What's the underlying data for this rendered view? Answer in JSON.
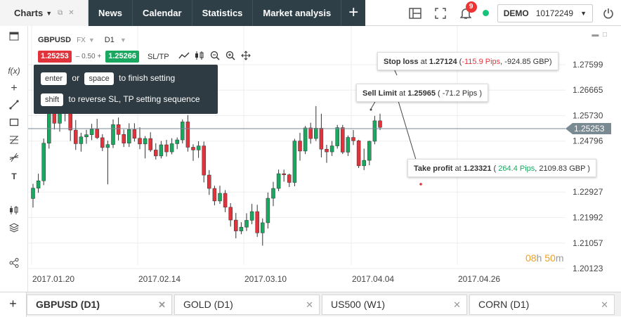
{
  "top_menu": {
    "label": "Charts"
  },
  "nav": [
    "News",
    "Calendar",
    "Statistics",
    "Market analysis"
  ],
  "plus_tab": "+",
  "notifications": {
    "count": "9"
  },
  "account": {
    "type": "DEMO",
    "number": "10172249"
  },
  "instrument": {
    "symbol": "GBPUSD",
    "type": "FX",
    "timeframe": "D1"
  },
  "prices": {
    "sell": "1.25253",
    "spread": "0.50",
    "buy": "1.25266",
    "sltp": "SL/TP"
  },
  "tooltip": {
    "key1": "enter",
    "or": "or",
    "key2": "space",
    "text1": "to finish setting",
    "key3": "shift",
    "text2": "to reverse SL, TP setting sequence"
  },
  "orders": {
    "stop_loss": {
      "label": "Stop loss",
      "at": "at",
      "price": "1.27124",
      "pips": "-115.9 Pips",
      "amount": "-924.85 GBP"
    },
    "sell_limit": {
      "label": "Sell Limit",
      "at": "at",
      "price": "1.25965",
      "pips": "-71.2 Pips"
    },
    "take_profit": {
      "label": "Take profit",
      "at": "at",
      "price": "1.23321",
      "pips": "264.4 Pips",
      "amount": "2109.83 GBP"
    }
  },
  "countdown": {
    "hours": "08",
    "h": "h",
    "minutes": "50",
    "m": "m"
  },
  "colors": {
    "bull": "#1aa860",
    "bear": "#e0333c",
    "nav_bg": "#2e3f48",
    "tooltip_bg": "#2e3b42",
    "countdown": "#f0a020"
  },
  "chart_data": {
    "type": "candlestick",
    "current_price": 1.25253,
    "y_ticks": [
      "1.27599",
      "1.26665",
      "1.25730",
      "1.24796",
      "1.22927",
      "1.21992",
      "1.21057",
      "1.20123"
    ],
    "x_ticks": [
      "2017.01.20",
      "2017.02.14",
      "2017.03.10",
      "2017.04.04",
      "2017.04.26"
    ],
    "ylim": [
      1.2012,
      1.2795
    ],
    "candles": [
      [
        1.2269,
        1.2323,
        1.2236,
        1.2307
      ],
      [
        1.2307,
        1.236,
        1.229,
        1.2334
      ],
      [
        1.2334,
        1.2489,
        1.2318,
        1.2472
      ],
      [
        1.2472,
        1.262,
        1.2452,
        1.2594
      ],
      [
        1.2594,
        1.2626,
        1.2522,
        1.2545
      ],
      [
        1.2545,
        1.2598,
        1.2514,
        1.2581
      ],
      [
        1.2581,
        1.2658,
        1.2552,
        1.2595
      ],
      [
        1.2595,
        1.2609,
        1.248,
        1.252
      ],
      [
        1.252,
        1.2557,
        1.2447,
        1.247
      ],
      [
        1.247,
        1.251,
        1.2441,
        1.2495
      ],
      [
        1.2495,
        1.2521,
        1.247,
        1.2503
      ],
      [
        1.2503,
        1.2543,
        1.2483,
        1.2523
      ],
      [
        1.2523,
        1.2561,
        1.2487,
        1.2492
      ],
      [
        1.2492,
        1.2505,
        1.2443,
        1.2456
      ],
      [
        1.2456,
        1.2481,
        1.2321,
        1.2467
      ],
      [
        1.2467,
        1.2559,
        1.2454,
        1.254
      ],
      [
        1.254,
        1.2566,
        1.2482,
        1.2504
      ],
      [
        1.2504,
        1.2522,
        1.2458,
        1.2472
      ],
      [
        1.2472,
        1.2545,
        1.2458,
        1.2522
      ],
      [
        1.2522,
        1.2545,
        1.2478,
        1.249
      ],
      [
        1.249,
        1.253,
        1.245,
        1.2469
      ],
      [
        1.2469,
        1.2498,
        1.2416,
        1.2489
      ],
      [
        1.2489,
        1.2512,
        1.244,
        1.2447
      ],
      [
        1.2447,
        1.2472,
        1.2412,
        1.2425
      ],
      [
        1.2425,
        1.248,
        1.2416,
        1.2466
      ],
      [
        1.2466,
        1.2484,
        1.2423,
        1.244
      ],
      [
        1.244,
        1.249,
        1.2431,
        1.247
      ],
      [
        1.247,
        1.2493,
        1.245,
        1.2484
      ],
      [
        1.2484,
        1.2559,
        1.2471,
        1.255
      ],
      [
        1.255,
        1.2575,
        1.2441,
        1.2457
      ],
      [
        1.2457,
        1.2468,
        1.2407,
        1.2447
      ],
      [
        1.2447,
        1.2479,
        1.2418,
        1.2462
      ],
      [
        1.2462,
        1.2478,
        1.2328,
        1.2355
      ],
      [
        1.2355,
        1.2373,
        1.2282,
        1.2306
      ],
      [
        1.2306,
        1.2316,
        1.2244,
        1.226
      ],
      [
        1.226,
        1.2316,
        1.2249,
        1.2288
      ],
      [
        1.2288,
        1.23,
        1.2219,
        1.2237
      ],
      [
        1.2237,
        1.2252,
        1.2166,
        1.219
      ],
      [
        1.219,
        1.2216,
        1.2123,
        1.215
      ],
      [
        1.215,
        1.2182,
        1.2138,
        1.2164
      ],
      [
        1.2164,
        1.2215,
        1.215,
        1.2189
      ],
      [
        1.2189,
        1.2249,
        1.2175,
        1.2221
      ],
      [
        1.2221,
        1.2246,
        1.2128,
        1.2143
      ],
      [
        1.2143,
        1.2196,
        1.2096,
        1.218
      ],
      [
        1.218,
        1.2291,
        1.2159,
        1.227
      ],
      [
        1.227,
        1.233,
        1.2241,
        1.2306
      ],
      [
        1.2306,
        1.2375,
        1.2296,
        1.236
      ],
      [
        1.236,
        1.2375,
        1.2331,
        1.2356
      ],
      [
        1.2356,
        1.236,
        1.2311,
        1.2328
      ],
      [
        1.2328,
        1.2488,
        1.2314,
        1.248
      ],
      [
        1.248,
        1.251,
        1.2408,
        1.2443
      ],
      [
        1.2443,
        1.2535,
        1.2432,
        1.2528
      ],
      [
        1.2528,
        1.2547,
        1.247,
        1.2489
      ],
      [
        1.2489,
        1.2608,
        1.248,
        1.2527
      ],
      [
        1.2527,
        1.258,
        1.242,
        1.245
      ],
      [
        1.245,
        1.2466,
        1.24,
        1.244
      ],
      [
        1.244,
        1.248,
        1.2425,
        1.2462
      ],
      [
        1.2462,
        1.2539,
        1.2452,
        1.2529
      ],
      [
        1.2529,
        1.2539,
        1.2432,
        1.2439
      ],
      [
        1.2439,
        1.25,
        1.2425,
        1.2493
      ],
      [
        1.2493,
        1.252,
        1.2465,
        1.2481
      ],
      [
        1.2481,
        1.2484,
        1.2381,
        1.2389
      ],
      [
        1.2389,
        1.2452,
        1.2373,
        1.2409
      ],
      [
        1.2409,
        1.2481,
        1.2391,
        1.2479
      ],
      [
        1.2479,
        1.2572,
        1.2468,
        1.2554
      ],
      [
        1.2554,
        1.258,
        1.252,
        1.253
      ]
    ],
    "orders": [
      {
        "name": "Stop loss",
        "price": 1.27124
      },
      {
        "name": "Sell Limit",
        "price": 1.25965
      },
      {
        "name": "Take profit",
        "price": 1.23321
      }
    ]
  }
}
